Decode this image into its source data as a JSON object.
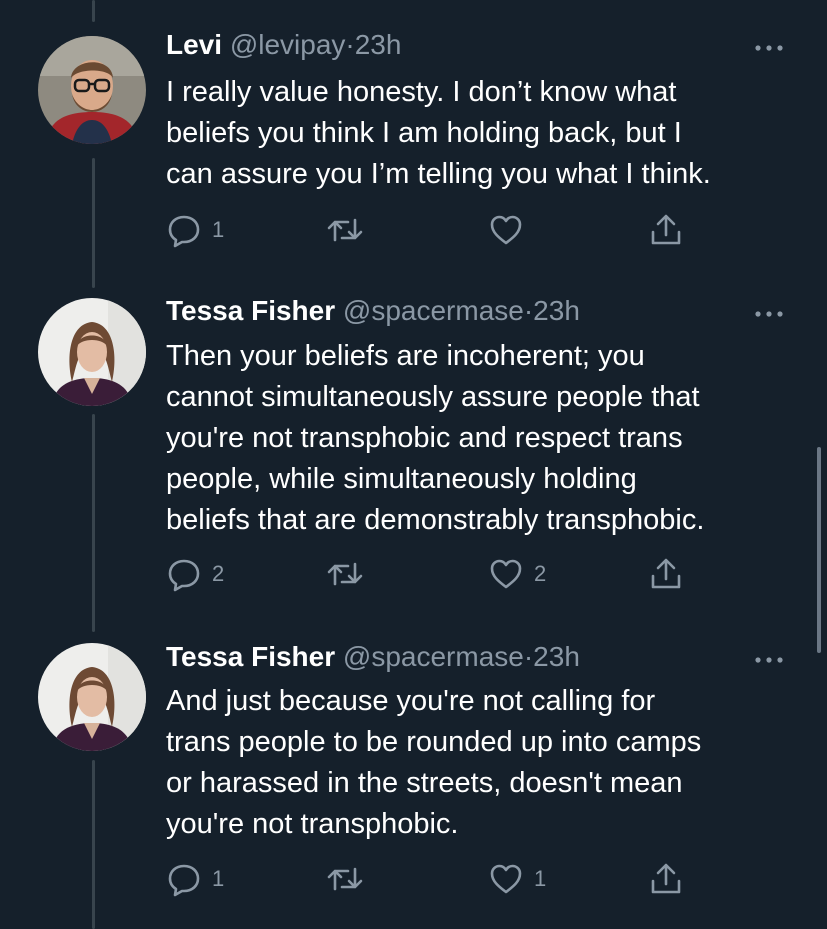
{
  "tweets": [
    {
      "name": "Levi",
      "handle": "@levipay",
      "separator": "·",
      "time": "23h",
      "text_lines": [
        "I really value honesty. I don’t know what",
        "beliefs you think I am holding back, but I",
        "can assure you I’m telling you what I think."
      ],
      "reply_count": "1",
      "retweet_count": "",
      "like_count": ""
    },
    {
      "name": "Tessa Fisher",
      "handle": "@spacermase",
      "separator": "·",
      "time": "23h",
      "text_lines": [
        "Then your beliefs are incoherent; you",
        "cannot simultaneously assure people that",
        "you're not transphobic and respect trans",
        "people, while simultaneously holding",
        "beliefs that are demonstrably transphobic."
      ],
      "reply_count": "2",
      "retweet_count": "",
      "like_count": "2"
    },
    {
      "name": "Tessa Fisher",
      "handle": "@spacermase",
      "separator": "·",
      "time": "23h",
      "text_lines": [
        "And just because you're not calling for",
        "trans people to be rounded up into camps",
        "or harassed in the streets, doesn't mean",
        "you're not transphobic."
      ],
      "reply_count": "1",
      "retweet_count": "",
      "like_count": "1"
    }
  ],
  "icons": {
    "reply": "reply-icon",
    "retweet": "retweet-icon",
    "like": "like-icon",
    "share": "share-icon",
    "more": "more-icon"
  },
  "colors": {
    "background": "#15202b",
    "primary_text": "#ffffff",
    "secondary_text": "#8b98a5",
    "thread_line": "#38444d"
  }
}
